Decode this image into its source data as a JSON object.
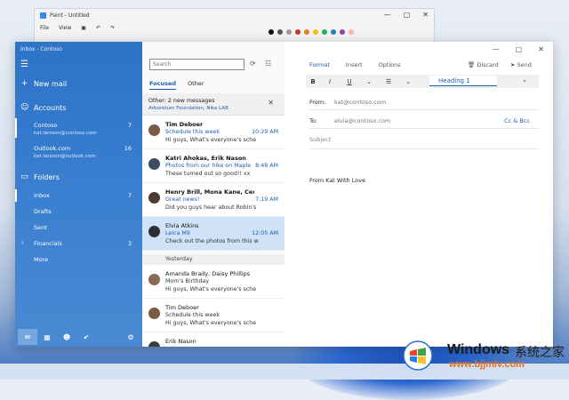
{
  "paint": {
    "title": "Paint - Untitled",
    "menu": [
      "File",
      "View"
    ],
    "controls": [
      "—",
      "▢",
      "✕"
    ],
    "swatch_colors": [
      "#111111",
      "#555555",
      "#9a9a9a",
      "#c0392b",
      "#e67e22",
      "#f1c40f",
      "#27ae60",
      "#2980b9",
      "#8e44ad",
      "#f5b7b1"
    ]
  },
  "mail": {
    "title": "Inbox - Contoso",
    "new_mail": "New mail",
    "accounts_label": "Accounts",
    "accounts": [
      {
        "name": "Contoso",
        "email": "kat.larsson@contoso.com",
        "count": "7"
      },
      {
        "name": "Outlook.com",
        "email": "kat.larsson@outlook.com",
        "count": "16"
      }
    ],
    "folders_label": "Folders",
    "folders": [
      {
        "name": "Inbox",
        "count": "7"
      },
      {
        "name": "Drafts",
        "count": ""
      },
      {
        "name": "Sent",
        "count": ""
      },
      {
        "name": "Financials",
        "count": "3"
      },
      {
        "name": "More",
        "count": ""
      }
    ],
    "search_placeholder": "Search",
    "tabs": {
      "focused": "Focused",
      "other": "Other"
    },
    "other_banner": {
      "title": "Other: 2 new messages",
      "senders": "Arboretum Foundation, Nike LAB"
    },
    "messages": [
      {
        "from": "Tim Deboer",
        "subject": "Schedule this week",
        "preview": "Hi guys, What's everyone's sche",
        "time": "10:29 AM",
        "avatar_color": "#7a5a44"
      },
      {
        "from": "Katri Ahokas, Erik Nason",
        "subject": "Photos from our hike on Maple",
        "preview": "These turned out so good!! xx",
        "time": "8:48 AM",
        "avatar_color": "#3d4e63"
      },
      {
        "from": "Henry Brill, Mona Kane, Cecil Fo",
        "subject": "Great news!",
        "preview": "Did you guys hear about Robin's",
        "time": "7:19 AM",
        "avatar_color": "#4b3b33"
      },
      {
        "from": "Elvia Atkins",
        "subject": "Leica M9",
        "preview": "Check out the photos from this w",
        "time": "12:05 AM",
        "avatar_color": "#2f2f33"
      }
    ],
    "yesterday_label": "Yesterday",
    "older_messages": [
      {
        "from": "Amanda Brady, Daisy Phillips",
        "subject": "Mom's Birthday",
        "preview": "Hi guys, What's everyone's sche",
        "avatar_color": "#8b6a55"
      },
      {
        "from": "Tim Deboer",
        "subject": "Schedule this week",
        "preview": "Hi guys, What's everyone's sche",
        "avatar_color": "#7a5a44"
      },
      {
        "from": "Erik Nason",
        "subject": "",
        "preview": "",
        "avatar_color": "#3b3b3b"
      }
    ],
    "compose": {
      "tabs": [
        "Format",
        "Insert",
        "Options"
      ],
      "discard": "Discard",
      "send": "Send",
      "toolbar": [
        "B",
        "I",
        "U",
        "⌄",
        "☰",
        "⌄"
      ],
      "heading": "Heading 1",
      "from_label": "From:",
      "from_value": "kat@contoso.com",
      "to_label": "To:",
      "to_value": "elvia@contoso.com",
      "cc_bcc": "Cc & Bcc",
      "subject_placeholder": "Subject",
      "body": "From Kat With Love"
    },
    "window_controls": [
      "—",
      "▢",
      "✕"
    ]
  },
  "watermark": {
    "title": "Windows",
    "cn": "系统之家",
    "url": "www.bjjmlv.com"
  }
}
